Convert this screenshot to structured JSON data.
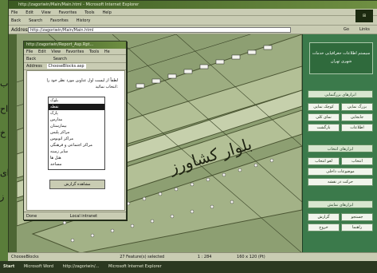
{
  "window": {
    "title": "http://zagoriwin/Main/Main.html - Microsoft Internet Explorer",
    "menu": [
      "File",
      "Edit",
      "View",
      "Favorites",
      "Tools",
      "Help"
    ],
    "toolbar": [
      "Back",
      "Search",
      "Favorites",
      "History"
    ],
    "address_label": "Address",
    "address_value": "http://zagoriwin/Main/Main.html",
    "go_label": "Go",
    "links_label": "Links"
  },
  "map": {
    "street_label": "بلوار کشاورز"
  },
  "right_panel": {
    "header_title": "سیستم اطلاعات جغرافیایی خدمات شهری تهران",
    "sections": [
      {
        "title": "ابزارهای بزرگنمایی",
        "buttons": [
          "بزرگ نمایی",
          "کوچک نمایی",
          "جابجایی",
          "نمای کلی",
          "اطلاعات",
          "بازگشت"
        ]
      },
      {
        "title": "ابزارهای انتخاب",
        "buttons": [
          "انتخاب",
          "لغو انتخاب",
          "موضوعات داخلی",
          "حرکت در نقشه"
        ]
      },
      {
        "title": "ابزارهای نمایش",
        "buttons": [
          "جستجو",
          "گزارش",
          "راهنما",
          "خروج"
        ]
      }
    ]
  },
  "popup": {
    "title": "http://zagoriwin/Report_Asp.Rpt...",
    "menu": [
      "File",
      "Edit",
      "View",
      "Favorites",
      "Tools",
      "He"
    ],
    "toolbar": [
      "Back",
      "Search"
    ],
    "address_label": "Address",
    "address_value": "ChooseBlocks.asp",
    "instruction": "لطفاً از لیست اول عناوین مورد نظر خود را انتخاب نمائید:",
    "list_items": [
      "بلوک",
      "نقطه",
      "پارک",
      "مدارس",
      "بیمارستان",
      "مراکز پلیس",
      "مراکز اتوبوس",
      "مراکز اجتماعی و فرهنگی",
      "سایر زمینه",
      "هتل ها",
      "مساجد"
    ],
    "selected_index": 1,
    "button_label": "مشاهده گزارش",
    "status_left": "Done",
    "status_right": "Local intranet"
  },
  "statusbar": {
    "left": "ChooseBlocks",
    "middle": "27 Feature(s) selected",
    "scale": "1 : 284",
    "coords": "160 x 120 (Pt)"
  },
  "taskbar": {
    "start": "Start",
    "items": [
      "Microsoft Word",
      "http://zagoriwin/...",
      "Microsoft Internet Explorer"
    ]
  },
  "background_text": [
    "ب",
    "اح",
    "خ",
    "ای",
    "ز"
  ]
}
